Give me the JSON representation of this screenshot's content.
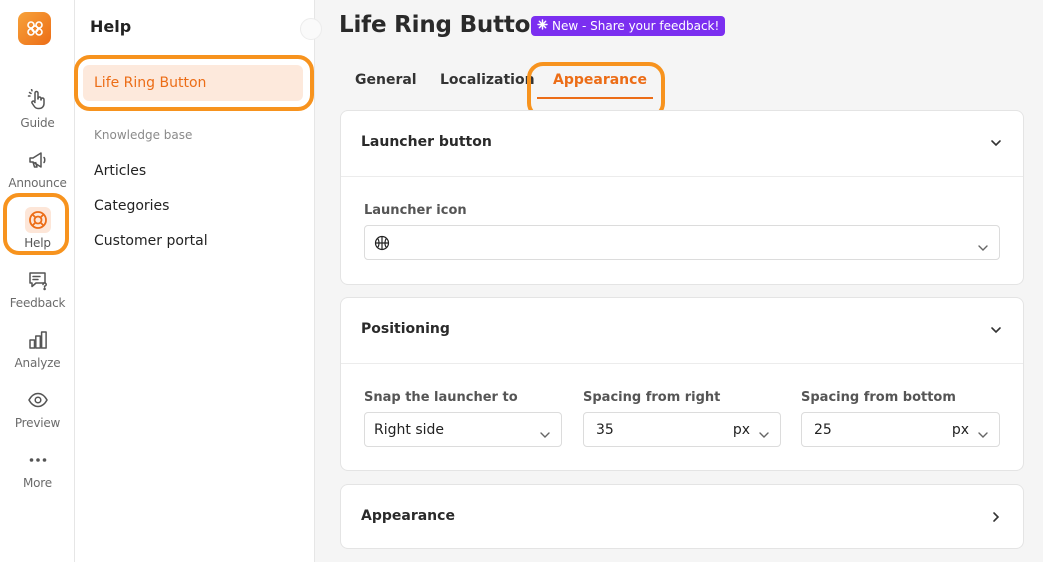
{
  "rail": {
    "items": [
      {
        "label": "Guide",
        "icon": "hand-pointer-icon"
      },
      {
        "label": "Announce",
        "icon": "megaphone-icon"
      },
      {
        "label": "Help",
        "icon": "life-ring-icon"
      },
      {
        "label": "Feedback",
        "icon": "feedback-icon"
      },
      {
        "label": "Analyze",
        "icon": "bar-chart-icon"
      },
      {
        "label": "Preview",
        "icon": "eye-icon"
      },
      {
        "label": "More",
        "icon": "dots-icon"
      }
    ]
  },
  "sidebar": {
    "title": "Help",
    "active_item": "Life Ring Button",
    "section_label": "Knowledge base",
    "links": [
      "Articles",
      "Categories",
      "Customer portal"
    ]
  },
  "header": {
    "title": "Life Ring Button",
    "badge": "New - Share your feedback!"
  },
  "tabs": {
    "items": [
      "General",
      "Localization",
      "Appearance"
    ],
    "active": "Appearance"
  },
  "launcher_card": {
    "title": "Launcher button",
    "icon_label": "Launcher icon",
    "selected_icon": "basketball-icon"
  },
  "positioning_card": {
    "title": "Positioning",
    "snap_label": "Snap the launcher to",
    "snap_value": "Right side",
    "right_label": "Spacing from right",
    "right_value": "35",
    "right_unit": "px",
    "bottom_label": "Spacing from bottom",
    "bottom_value": "25",
    "bottom_unit": "px"
  },
  "appearance_card": {
    "title": "Appearance"
  },
  "colors": {
    "accent": "#ec6d17",
    "highlight": "#f7931e",
    "badge": "#7b2ff0"
  }
}
